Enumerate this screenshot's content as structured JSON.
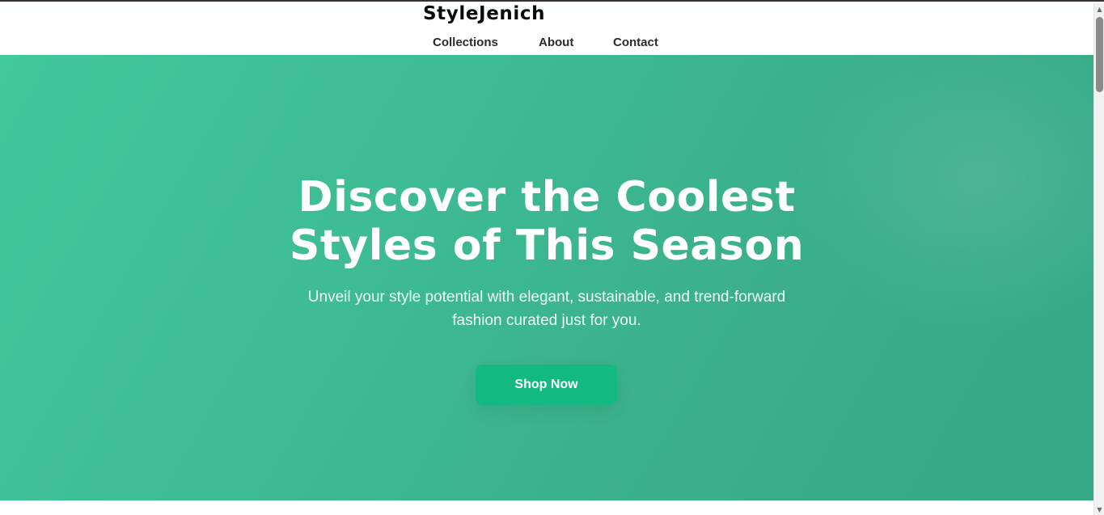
{
  "brand": {
    "name": "StyleJenich"
  },
  "nav": {
    "items": [
      {
        "label": "Collections"
      },
      {
        "label": "About"
      },
      {
        "label": "Contact"
      }
    ]
  },
  "hero": {
    "title_line1": "Discover the Coolest",
    "title_line2": "Styles of This Season",
    "subtitle": "Unveil your style potential with elegant, sustainable, and trend-forward fashion curated just for you.",
    "cta_label": "Shop Now"
  },
  "scrollbar": {
    "up_icon": "triangle-up",
    "down_icon": "triangle-down"
  },
  "colors": {
    "accent": "#12b981",
    "hero_gradient_start": "#41c89b",
    "hero_gradient_end": "#35a886",
    "text_dark": "#0b0b0b"
  }
}
